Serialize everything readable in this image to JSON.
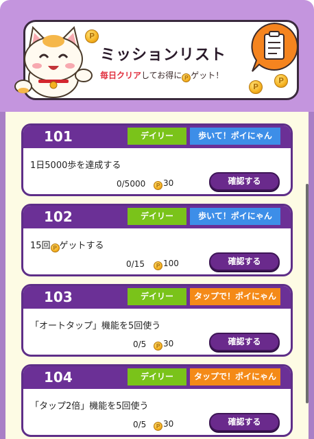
{
  "banner": {
    "title": "ミッションリスト",
    "subtitle_highlight": "毎日クリア",
    "subtitle_mid": "してお得に",
    "subtitle_end": "ゲット！"
  },
  "coin_symbol": "P",
  "missions": [
    {
      "number": "101",
      "frequency": "デイリー",
      "category": "歩いて！ポイにゃん",
      "category_color": "#3d8ee8",
      "description_pre": "1日5000歩を達成する",
      "description_post": "",
      "progress": "0/5000",
      "reward": "30",
      "button": "確認する"
    },
    {
      "number": "102",
      "frequency": "デイリー",
      "category": "歩いて！ポイにゃん",
      "category_color": "#3d8ee8",
      "description_pre": "15回",
      "description_post": "ゲットする",
      "progress": "0/15",
      "reward": "100",
      "button": "確認する"
    },
    {
      "number": "103",
      "frequency": "デイリー",
      "category": "タップで！ポイにゃん",
      "category_color": "#f48a18",
      "description_pre": "「オートタップ」機能を5回使う",
      "description_post": "",
      "progress": "0/5",
      "reward": "30",
      "button": "確認する"
    },
    {
      "number": "104",
      "frequency": "デイリー",
      "category": "タップで！ポイにゃん",
      "category_color": "#f48a18",
      "description_pre": "「タップ2倍」機能を5回使う",
      "description_post": "",
      "progress": "0/5",
      "reward": "30",
      "button": "確認する"
    }
  ],
  "colors": {
    "header_purple": "#c495de",
    "card_header": "#6b3096",
    "daily_green": "#7ac31a",
    "walk_blue": "#3d8ee8",
    "tap_orange": "#f48a18",
    "button_purple": "#6a2a8c",
    "background": "#fdfbe4"
  },
  "icons": [
    "lucky-cat-mascot",
    "clipboard-icon",
    "coin-icon"
  ]
}
